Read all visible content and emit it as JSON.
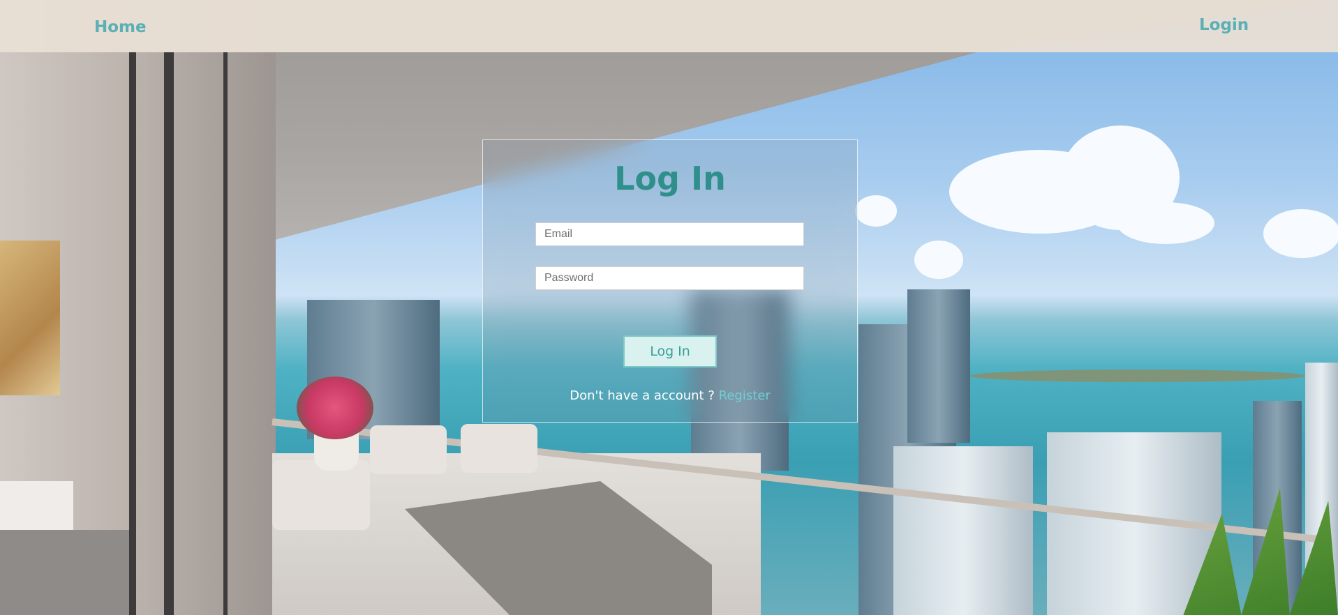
{
  "nav": {
    "home_label": "Home",
    "login_label": "Login"
  },
  "login_card": {
    "title": "Log In",
    "email_placeholder": "Email",
    "email_value": "",
    "password_placeholder": "Password",
    "password_value": "",
    "submit_label": "Log In",
    "register_prompt": "Don't have a account ?",
    "register_link": "Register"
  },
  "colors": {
    "accent": "#5ab0b4",
    "title": "#2f8f8a",
    "navbar_bg": "#e8dfd4",
    "button_bg": "#d9f2ef",
    "button_border": "#7fcac6"
  }
}
